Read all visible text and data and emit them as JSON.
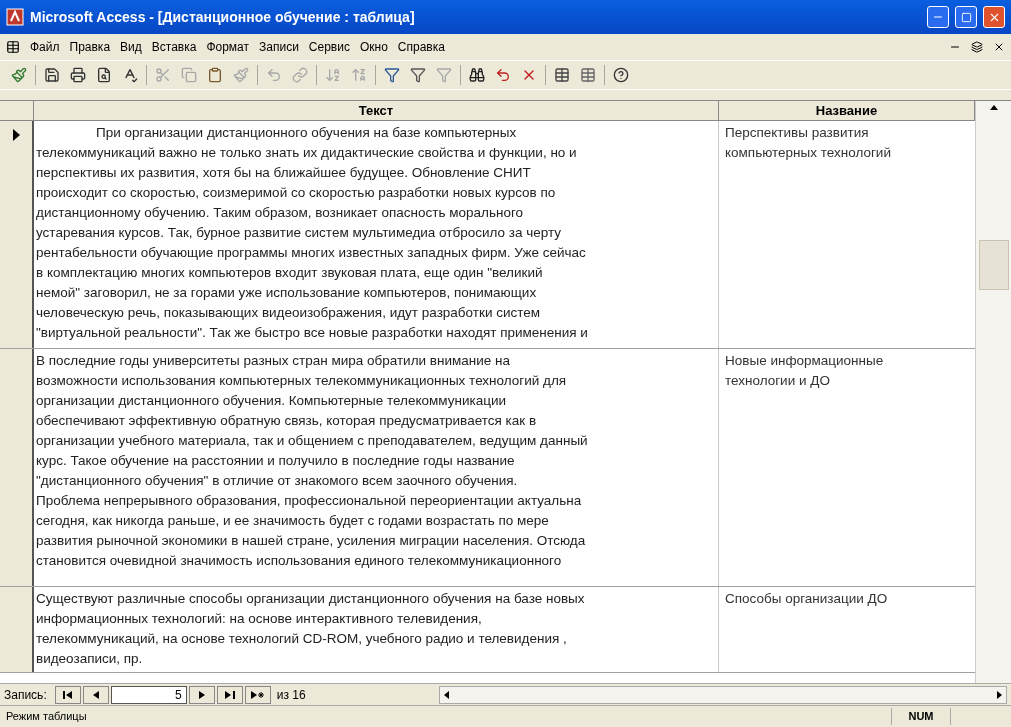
{
  "window": {
    "title": "Microsoft Access - [Дистанционное обучение : таблица]"
  },
  "menu": [
    "Файл",
    "Правка",
    "Вид",
    "Вставка",
    "Формат",
    "Записи",
    "Сервис",
    "Окно",
    "Справка"
  ],
  "table": {
    "columns": [
      "Текст",
      "Название"
    ],
    "rows": [
      {
        "current": true,
        "text": "При организации дистанционного обучения на базе компьютерных\nтелекоммуникаций важно не только знать их дидактические свойства и функции, но и\nперспективы их развития, хотя бы на ближайшее будущее. Обновление СНИТ\nпроисходит со скоростью, соизмеримой со скоростью разработки новых курсов по\nдистанционному обучению. Таким образом, возникает опасность морального\nустаревания курсов. Так, бурное развитие систем мультимедиа отбросило за черту\nрентабельности обучающие программы многих известных западных фирм. Уже сейчас\nв комплектацию многих компьютеров входит звуковая плата, еще один \"великий\nнемой\" заговорил, не за горами уже использование компьютеров, понимающих\nчеловеческую речь, показывающих видеоизображения, идут разработки систем\n\"виртуальной реальности\". Так же быстро все новые разработки находят применения и",
        "name": "Перспективы развития\nкомпьютерных технологий"
      },
      {
        "current": false,
        "text": "В последние годы университеты разных стран мира обратили внимание на\nвозможности использования компьютерных телекоммуникационных технологий для\nорганизации дистанционного обучения. Компьютерные телекоммуникации\nобеспечивают эффективную обратную связь, которая предусматривается как в\nорганизации учебного материала, так и общением с преподавателем, ведущим данный\nкурс. Такое обучение на расстоянии и получило в последние годы название\n\"дистанционного обучения\" в отличие от знакомого всем заочного обучения.\nПроблема непрерывного образования, профессиональной переориентации актуальна\nсегодня, как никогда раньше, и ее значимость будет с годами возрастать по мере\nразвития рыночной экономики в нашей стране, усиления миграции населения. Отсюда\nстановится очевидной значимость использования единого телекоммуникационного",
        "name": "Новые информационные\nтехнологии и ДО"
      },
      {
        "current": false,
        "text": "Существуют различные способы организации дистанционного обучения на базе новых\nинформационных технологий: на основе интерактивного телевидения,\nтелекоммуникаций, на основе технологий CD-ROM, учебного радио и телевидения ,\nвидеозаписи, пр.",
        "name": "Способы организации ДО"
      }
    ]
  },
  "navigator": {
    "label": "Запись:",
    "record": "5",
    "total": "из 16"
  },
  "status_bar": {
    "mode": "Режим таблицы",
    "num": "NUM"
  }
}
